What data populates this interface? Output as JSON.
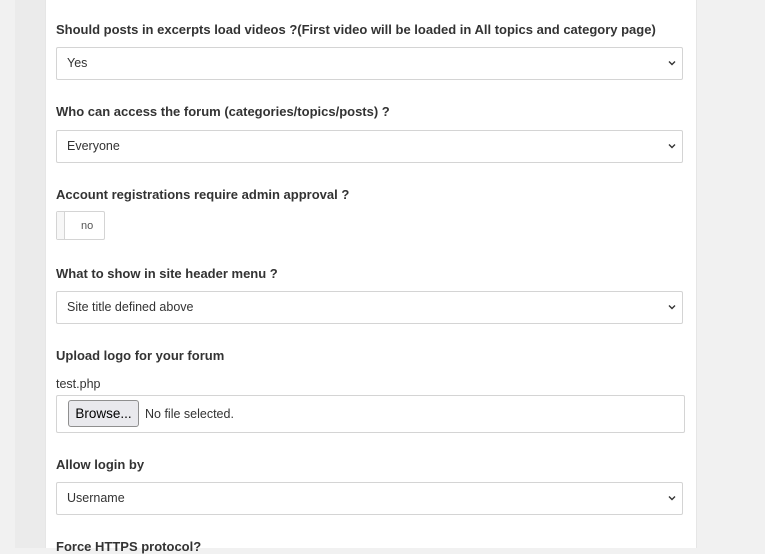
{
  "settings": {
    "excerpt_videos": {
      "label": "Should posts in excerpts load videos ?(First video will be loaded in All topics and category page)",
      "value": "Yes"
    },
    "forum_access": {
      "label": "Who can access the forum (categories/topics/posts) ?",
      "value": "Everyone"
    },
    "admin_approval": {
      "label": "Account registrations require admin approval ?",
      "state": "no"
    },
    "header_menu": {
      "label": "What to show in site header menu ?",
      "value": "Site title defined above"
    },
    "logo_upload": {
      "label": "Upload logo for your forum",
      "current_file": "test.php",
      "browse_label": "Browse...",
      "status": "No file selected."
    },
    "login_by": {
      "label": "Allow login by",
      "value": "Username"
    },
    "force_https": {
      "label": "Force HTTPS protocol?"
    }
  },
  "icons": {
    "select_chevron": "chevron-down-icon"
  },
  "colors": {
    "panel_bg": "#ffffff",
    "page_bg": "#f1f1f1",
    "border": "#d4d4d4",
    "text": "#333333"
  }
}
